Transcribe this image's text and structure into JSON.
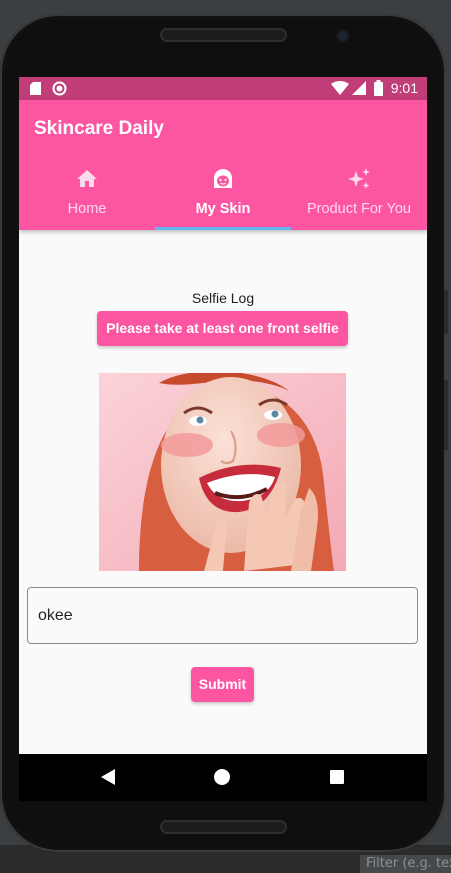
{
  "status_bar": {
    "time": "9:01"
  },
  "app": {
    "title": "Skincare Daily",
    "tabs": [
      {
        "label": "Home",
        "icon": "home-icon",
        "active": false
      },
      {
        "label": "My Skin",
        "icon": "face-icon",
        "active": true
      },
      {
        "label": "Product For You",
        "icon": "sparkles-icon",
        "active": false
      }
    ]
  },
  "main": {
    "section_title": "Selfie Log",
    "selfie_button_label": "Please take at least one front selfie",
    "note_value": "okee",
    "submit_label": "Submit"
  },
  "ide": {
    "filter_placeholder": "Filter (e.g. text"
  },
  "colors": {
    "primary": "#fc55a2",
    "status_bar": "#c13d78",
    "tab_indicator": "#64b5f6",
    "background": "#fafafa"
  }
}
